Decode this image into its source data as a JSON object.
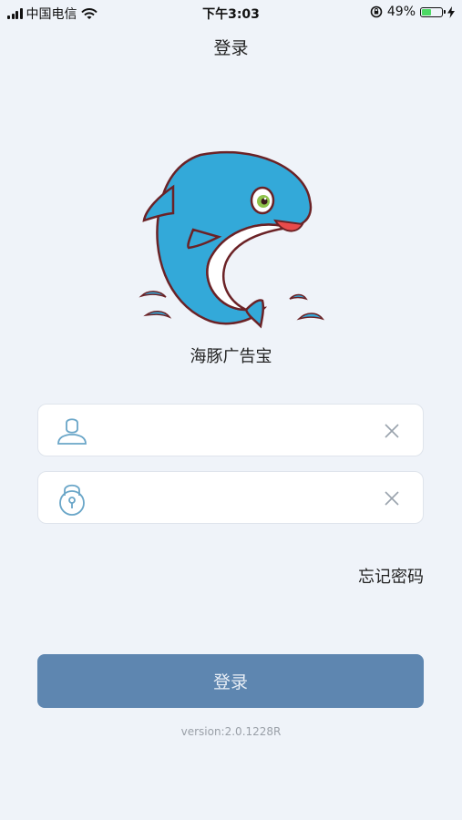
{
  "status_bar": {
    "carrier": "中国电信",
    "time": "下午3:03",
    "battery_percent": "49%",
    "battery_level": 0.49,
    "battery_color": "#4cd964"
  },
  "nav": {
    "title": "登录"
  },
  "app": {
    "name": "海豚广告宝",
    "logo": "dolphin-logo"
  },
  "form": {
    "username": {
      "value": "",
      "placeholder": "",
      "icon": "user-icon"
    },
    "password": {
      "value": "",
      "placeholder": "",
      "icon": "lock-icon"
    },
    "clear_icon": "close-icon",
    "forgot_password": "忘记密码",
    "login_button": "登录"
  },
  "version": "version:2.0.1228R",
  "colors": {
    "background": "#eff3f9",
    "button": "#5e86b0",
    "icon_stroke": "#6aa6c8"
  }
}
